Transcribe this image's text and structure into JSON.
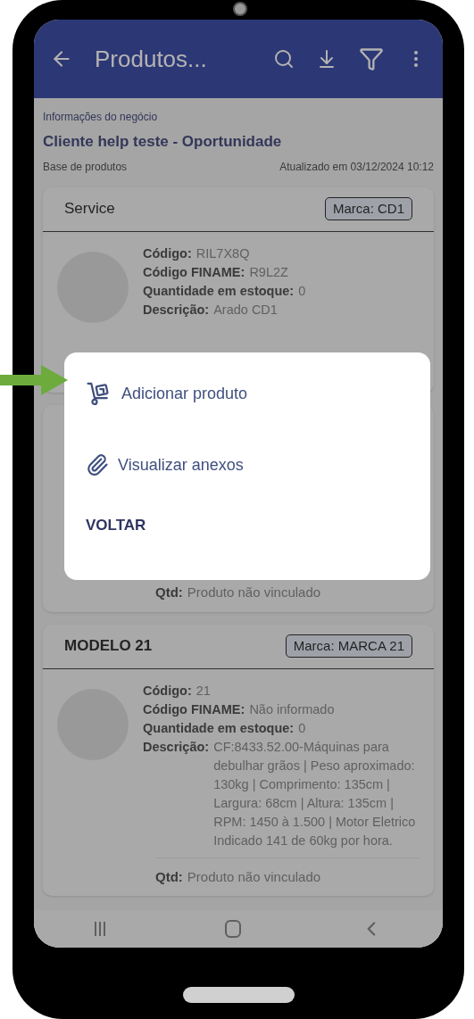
{
  "app_bar": {
    "title": "Produtos..."
  },
  "business": {
    "label": "Informações do negócio",
    "title": "Cliente help teste - Oportunidade",
    "base": "Base de produtos",
    "updated": "Atualizado em 03/12/2024 10:12"
  },
  "products": [
    {
      "name": "Service",
      "brand": "Marca: CD1",
      "fields": [
        {
          "label": "Código:",
          "value": "RIL7X8Q"
        },
        {
          "label": "Código FINAME:",
          "value": "R9L2Z"
        },
        {
          "label": "Quantidade em estoque:",
          "value": "0"
        },
        {
          "label": "Descrição:",
          "value": "Arado CD1"
        }
      ]
    },
    {
      "qtd": {
        "label": "Qtd:",
        "value": "Produto não vinculado"
      }
    },
    {
      "name": "MODELO 21",
      "brand": "Marca: MARCA 21",
      "fields": [
        {
          "label": "Código:",
          "value": "21"
        },
        {
          "label": "Código FINAME:",
          "value": "Não informado"
        },
        {
          "label": "Quantidade em estoque:",
          "value": "0"
        },
        {
          "label": "Descrição:",
          "value": "CF:8433.52.00-Máquinas para debulhar grãos | Peso aproximado: 130kg | Comprimento: 135cm | Largura: 68cm | Altura: 135cm | RPM: 1450 à 1.500 | Motor Eletrico Indicado 141 de 60kg por hora."
        }
      ],
      "qtd": {
        "label": "Qtd:",
        "value": "Produto não vinculado"
      }
    }
  ],
  "dialog": {
    "items": [
      {
        "kind": "cart",
        "label": "Adicionar produto"
      },
      {
        "kind": "attachment",
        "label": "Visualizar anexos"
      }
    ],
    "action": "VOLTAR"
  },
  "annotation": {
    "kind": "arrow"
  }
}
